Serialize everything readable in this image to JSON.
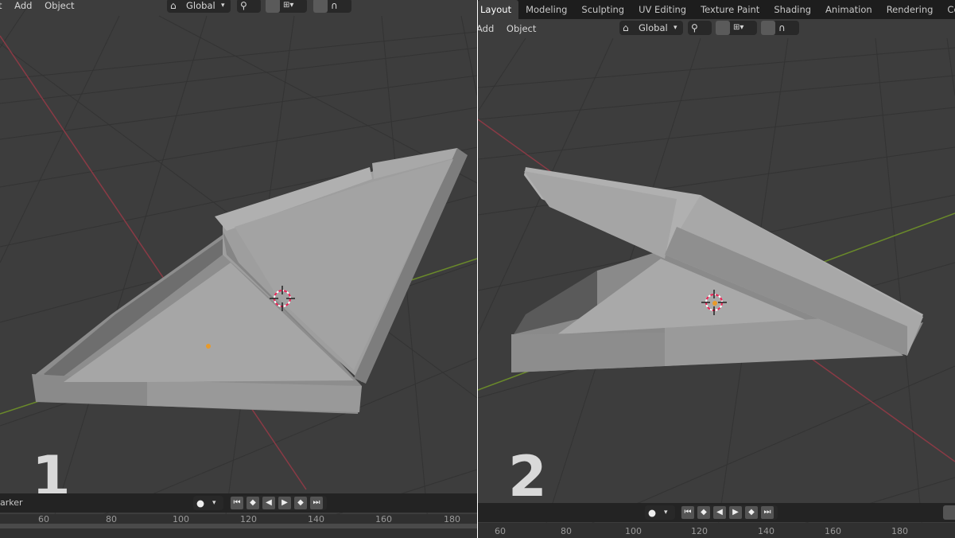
{
  "panel1": {
    "menu": [
      "t",
      "Add",
      "Object"
    ],
    "orientation": "Global",
    "timeline_label": "arker",
    "ruler_ticks": [
      "60",
      "80",
      "100",
      "120",
      "140",
      "160",
      "180"
    ],
    "number": "1"
  },
  "panel2": {
    "workspace_tabs": [
      "Layout",
      "Modeling",
      "Sculpting",
      "UV Editing",
      "Texture Paint",
      "Shading",
      "Animation",
      "Rendering",
      "Compositin"
    ],
    "menu": [
      "Add",
      "Object"
    ],
    "orientation": "Global",
    "ruler_ticks": [
      "60",
      "80",
      "100",
      "120",
      "140",
      "160",
      "180"
    ],
    "number": "2"
  },
  "colors": {
    "viewport_bg": "#3d3d3d",
    "grid": "#2f2f2f",
    "x_axis": "#8a3a45",
    "y_axis": "#6a8a2a",
    "mesh": "#9a9a9a"
  },
  "icons": [
    "transform-orientation-icon",
    "snap-icon",
    "proportional-edit-icon",
    "falloff-icon",
    "record-icon",
    "jump-start-icon",
    "keyframe-prev-icon",
    "play-reverse-icon",
    "play-icon",
    "keyframe-next-icon",
    "jump-end-icon",
    "cursor-3d-icon"
  ]
}
